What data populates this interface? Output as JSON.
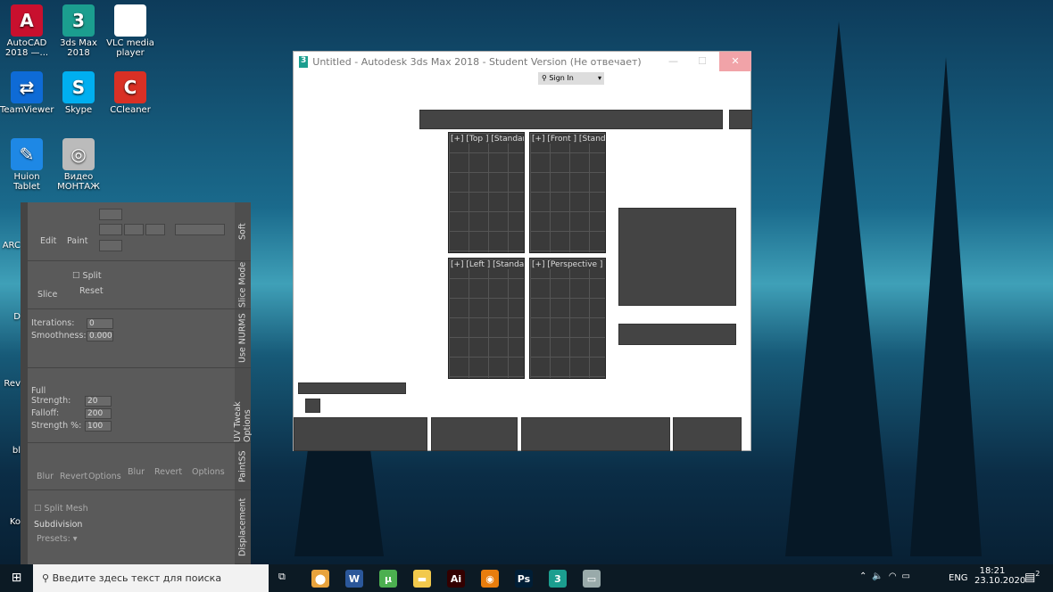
{
  "desktop": {
    "icons": [
      {
        "label": "AutoCAD 2018 —...",
        "glyph": "A",
        "color": "#c8102e"
      },
      {
        "label": "3ds Max 2018",
        "glyph": "3",
        "color": "#1b9e8f"
      },
      {
        "label": "VLC media player",
        "glyph": "",
        "color": "#ffffff"
      },
      {
        "label": "TeamViewer",
        "glyph": "⇄",
        "color": "#0e6bd6"
      },
      {
        "label": "Skype",
        "glyph": "S",
        "color": "#00aff0"
      },
      {
        "label": "CCleaner",
        "glyph": "C",
        "color": "#d93025"
      },
      {
        "label": "Huion Tablet",
        "glyph": "✎",
        "color": "#1e88e5"
      },
      {
        "label": "Видео МОНТАЖ",
        "glyph": "◎",
        "color": "#bbbbbb"
      }
    ],
    "partial_icons": [
      "ARC",
      "D",
      "Rev",
      "bl",
      "Ko"
    ]
  },
  "ribbon_panel": {
    "edit": "Edit",
    "paint": "Paint",
    "slice": "Slice",
    "split": "Split",
    "reset": "Reset",
    "iterations_label": "Iterations:",
    "iterations_value": "0",
    "smoothness_label": "Smoothness:",
    "smoothness_value": "0.000",
    "full_strength_label": "Full Strength:",
    "full_strength_value": "20",
    "falloff_label": "Falloff:",
    "falloff_value": "200",
    "strength_label": "Strength %:",
    "strength_value": "100",
    "blur": "Blur",
    "revert": "Revert",
    "options": "Options",
    "blur2": "Blur",
    "revert2": "Revert",
    "options2": "Options",
    "split_mesh": "Split Mesh",
    "subdivision": "Subdivision",
    "presets": "Presets:",
    "tabs": [
      "Soft",
      "Slice Mode",
      "Use NURMS",
      "UV Tweak Options",
      "PaintSS",
      "Displacement"
    ]
  },
  "window": {
    "title": "Untitled - Autodesk 3ds Max 2018 - Student Version (Не отвечает)",
    "sign_in": "Sign In",
    "viewports": [
      "[+] [Top ] [Standard",
      "[+] [Front ] [Standar",
      "[+] [Left ] [Standard",
      "[+] [Perspective ] [St"
    ]
  },
  "taskbar": {
    "search_placeholder": "Введите здесь текст для поиска",
    "lang": "ENG",
    "time": "18:21",
    "date": "23.10.2020",
    "notifications": "2",
    "apps": [
      {
        "glyph": "⬤",
        "color": "#e8a33d"
      },
      {
        "glyph": "W",
        "color": "#2b579a"
      },
      {
        "glyph": "µ",
        "color": "#4caf50"
      },
      {
        "glyph": "▬",
        "color": "#f2c94c"
      },
      {
        "glyph": "Ai",
        "color": "#330000"
      },
      {
        "glyph": "◉",
        "color": "#e87d0d"
      },
      {
        "glyph": "Ps",
        "color": "#001e36"
      },
      {
        "glyph": "3",
        "color": "#1b9e8f"
      },
      {
        "glyph": "▭",
        "color": "#9aa"
      }
    ]
  }
}
